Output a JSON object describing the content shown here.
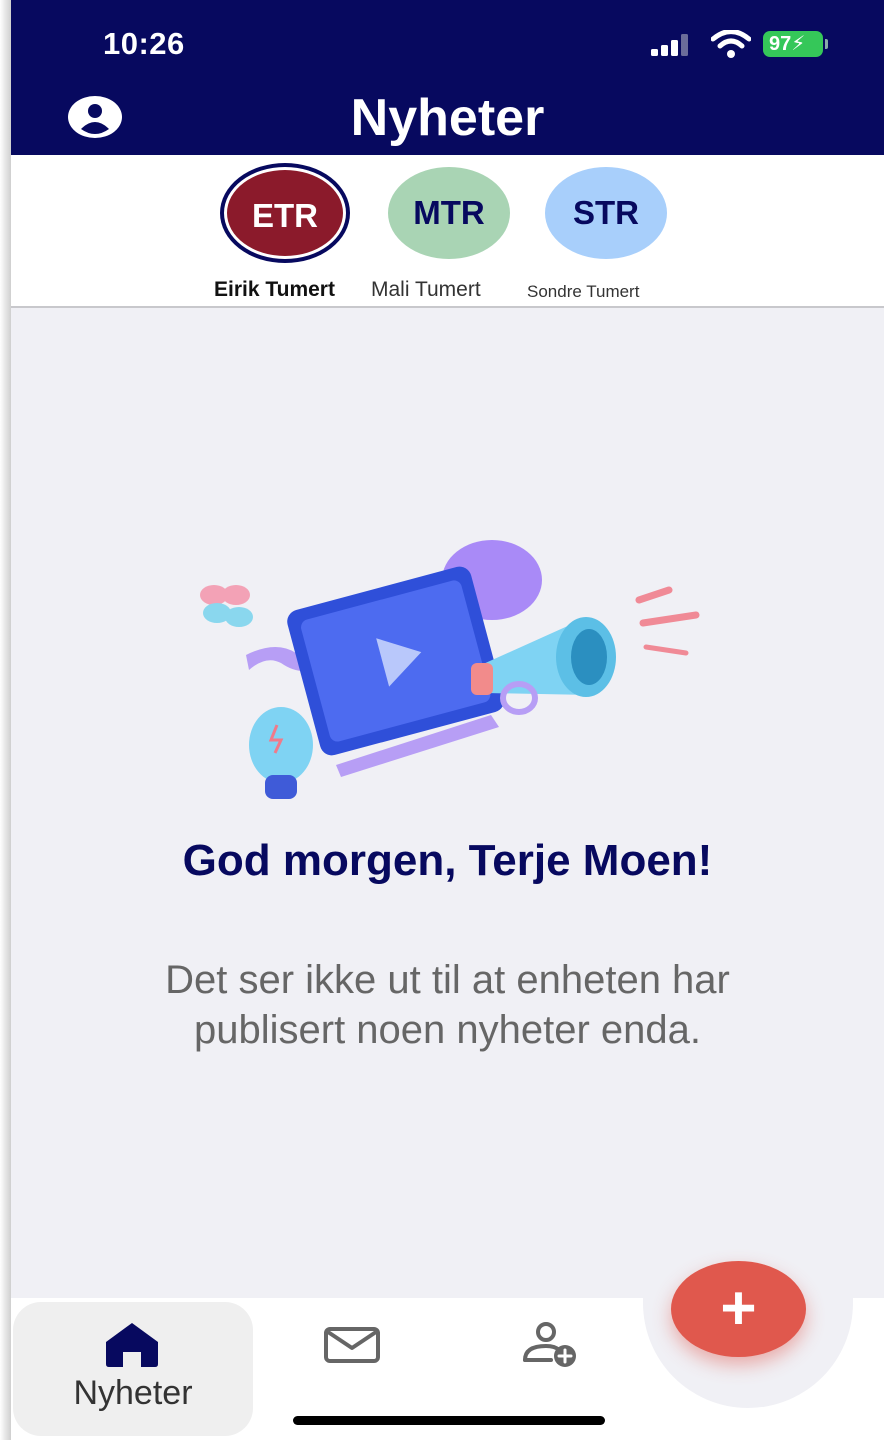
{
  "status_bar": {
    "time": "10:26",
    "battery": "97"
  },
  "header": {
    "title": "Nyheter"
  },
  "members": [
    {
      "initials": "ETR",
      "name": "Eirik Tumert",
      "color": "#8b1a2b",
      "selected": true
    },
    {
      "initials": "MTR",
      "name": "Mali Tumert",
      "color": "#a9d4b4",
      "selected": false
    },
    {
      "initials": "STR",
      "name": "Sondre Tumert",
      "color": "#a8cffb",
      "selected": false
    }
  ],
  "empty_state": {
    "greeting": "God morgen, Terje Moen!",
    "message": "Det ser ikke ut til at enheten har publisert noen nyheter enda."
  },
  "tabbar": {
    "items": [
      {
        "label": "Nyheter",
        "icon": "home-icon",
        "active": true
      },
      {
        "label": "",
        "icon": "mail-icon",
        "active": false
      },
      {
        "label": "",
        "icon": "add-user-icon",
        "active": false
      }
    ],
    "fab_icon": "+"
  },
  "colors": {
    "header_bg": "#07095f",
    "accent": "#e0584d",
    "page_bg": "#f0f0f5"
  }
}
